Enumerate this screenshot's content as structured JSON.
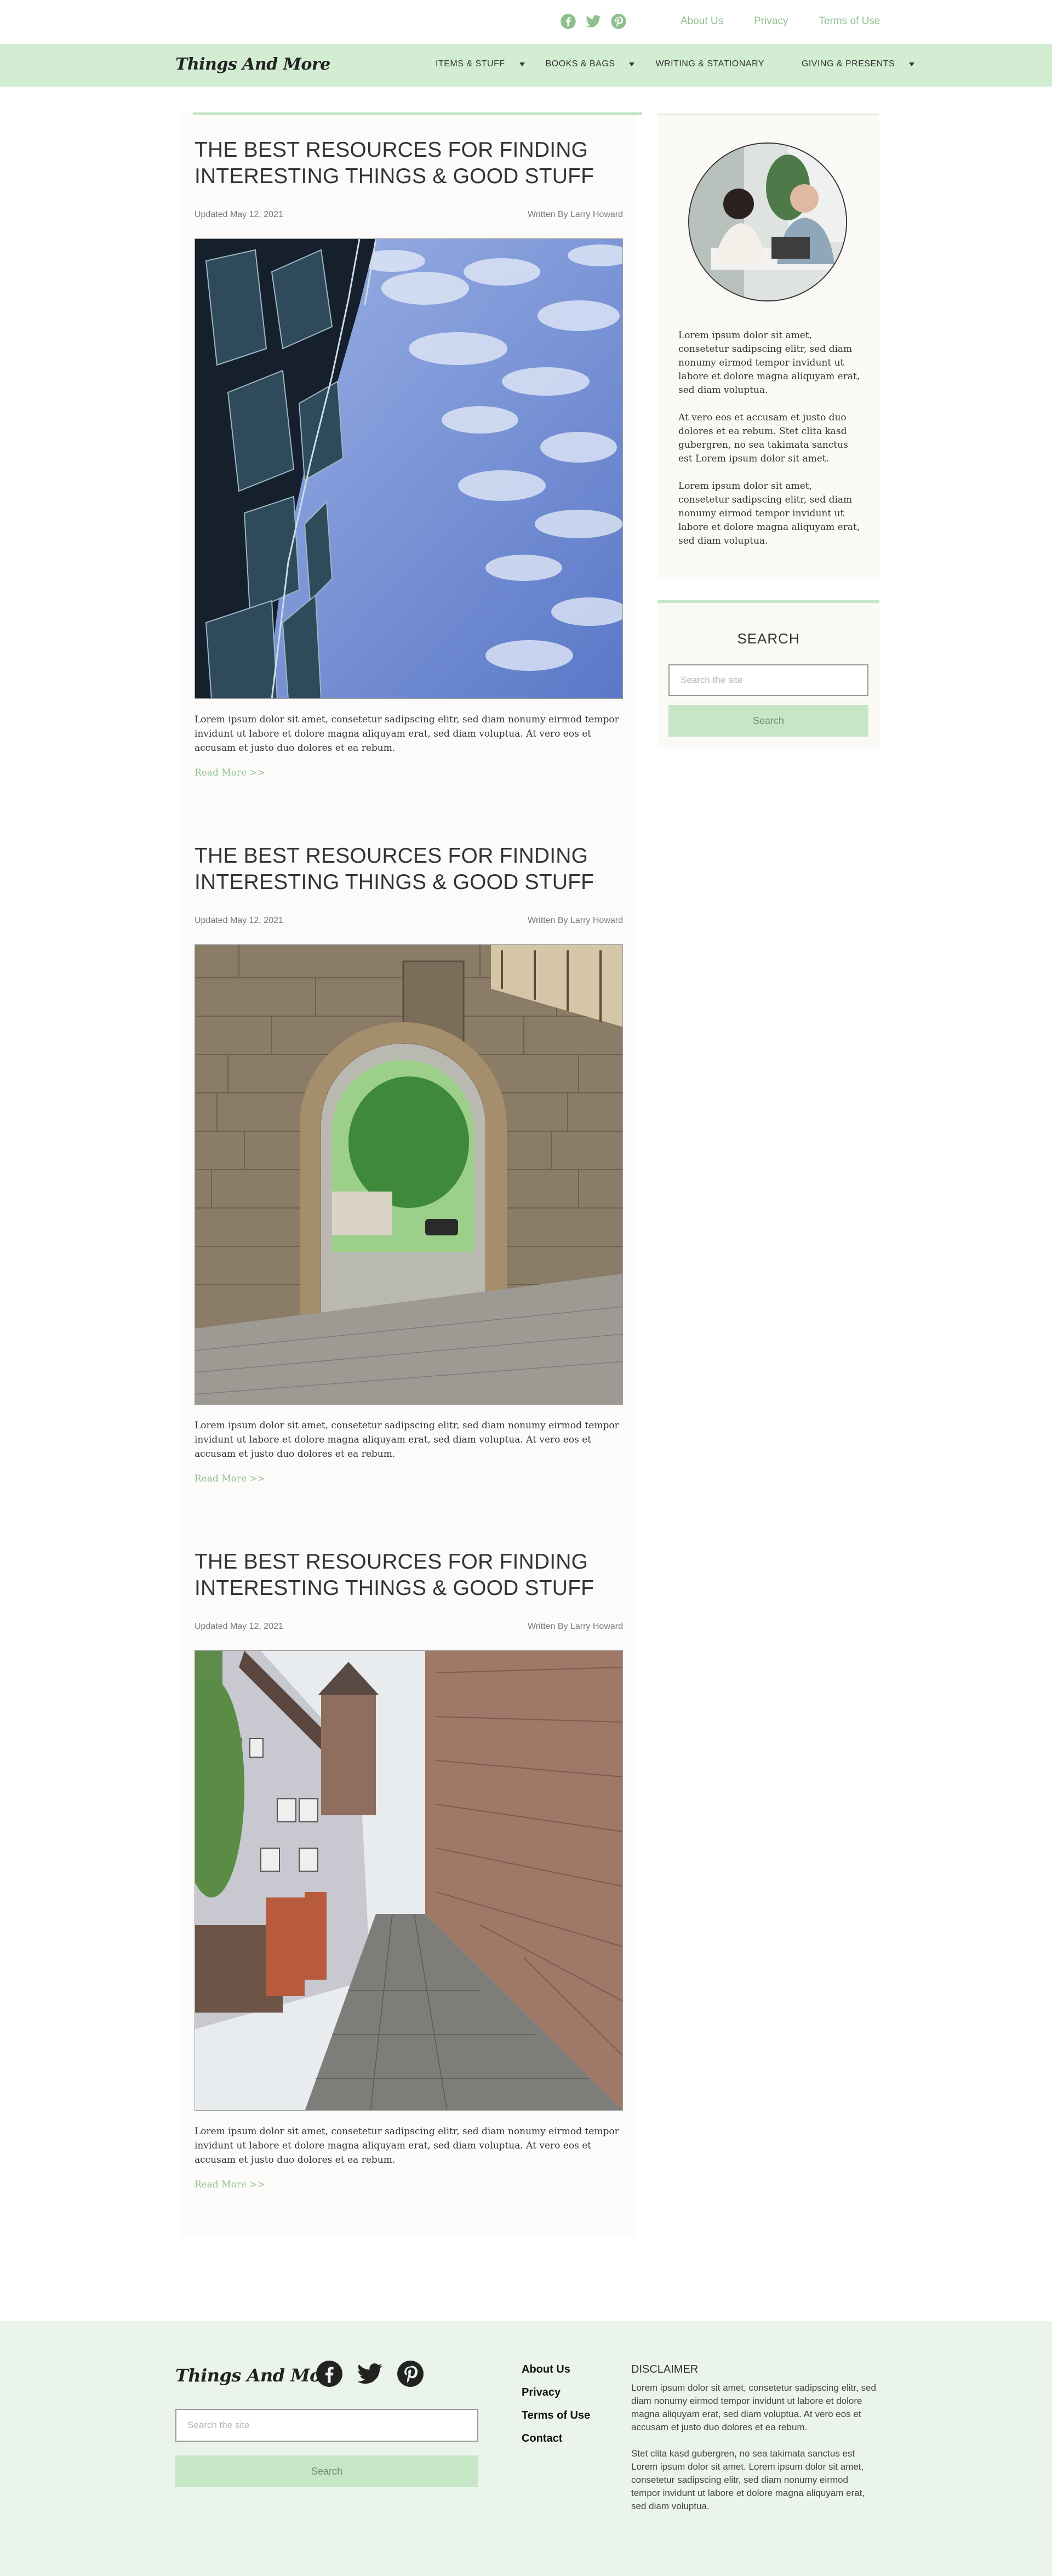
{
  "header": {
    "social": [
      {
        "icon": "facebook-icon"
      },
      {
        "icon": "twitter-icon"
      },
      {
        "icon": "pinterest-icon"
      }
    ],
    "links": [
      "About Us",
      "Privacy",
      "Terms of Use"
    ]
  },
  "nav": {
    "logo": "Things And More",
    "items": [
      {
        "label": "ITEMS & STUFF",
        "dropdown": true
      },
      {
        "label": "BOOKS & BAGS",
        "dropdown": true
      },
      {
        "label": "WRITING & STATIONARY",
        "dropdown": false
      },
      {
        "label": "GIVING & PRESENTS",
        "dropdown": true
      }
    ]
  },
  "posts": [
    {
      "title": "THE BEST RESOURCES FOR FINDING INTERESTING THINGS & GOOD STUFF",
      "date": "Updated May 12, 2021",
      "author": "Written By Larry Howard",
      "image": "glass-building-photo",
      "excerpt": "Lorem ipsum dolor sit amet, consetetur sadipscing elitr, sed diam nonumy eirmod tempor invidunt ut labore et dolore magna aliquyam erat, sed diam voluptua. At vero eos et accusam et justo duo dolores et ea rebum.",
      "read_more": "Read More >>"
    },
    {
      "title": "THE BEST RESOURCES FOR FINDING INTERESTING THINGS & GOOD STUFF",
      "date": "Updated May 12, 2021",
      "author": "Written By Larry Howard",
      "image": "stone-archway-photo",
      "excerpt": "Lorem ipsum dolor sit amet, consetetur sadipscing elitr, sed diam nonumy eirmod tempor invidunt ut labore et dolore magna aliquyam erat, sed diam voluptua. At vero eos et accusam et justo duo dolores et ea rebum.",
      "read_more": "Read More >>"
    },
    {
      "title": "THE BEST RESOURCES FOR FINDING INTERESTING THINGS & GOOD STUFF",
      "date": "Updated May 12, 2021",
      "author": "Written By Larry Howard",
      "image": "cobblestone-alley-photo",
      "excerpt": "Lorem ipsum dolor sit amet, consetetur sadipscing elitr, sed diam nonumy eirmod tempor invidunt ut labore et dolore magna aliquyam erat, sed diam voluptua. At vero eos et accusam et justo duo dolores et ea rebum.",
      "read_more": "Read More >>"
    }
  ],
  "sidebar": {
    "paragraphs": [
      "Lorem ipsum dolor sit amet, consetetur sadipscing elitr, sed diam nonumy eirmod tempor invidunt ut labore et dolore magna aliquyam erat, sed diam voluptua.",
      "At vero eos et accusam et justo duo dolores et ea rebum. Stet clita kasd gubergren, no sea takimata sanctus est Lorem ipsum dolor sit amet.",
      "Lorem ipsum dolor sit amet, consetetur sadipscing elitr, sed diam nonumy eirmod tempor invidunt ut labore et dolore magna aliquyam erat, sed diam voluptua."
    ],
    "search": {
      "heading": "SEARCH",
      "placeholder": "Search the site",
      "button": "Search"
    }
  },
  "footer": {
    "logo": "Things And More",
    "search": {
      "placeholder": "Search the site",
      "button": "Search"
    },
    "links": [
      "About Us",
      "Privacy",
      "Terms of Use",
      "Contact"
    ],
    "disclaimer": {
      "heading": "DISCLAIMER",
      "paragraphs": [
        "Lorem ipsum dolor sit amet, consetetur sadipscing elitr, sed diam nonumy eirmod tempor invidunt ut labore et dolore magna aliquyam erat, sed diam voluptua. At vero eos et accusam et justo duo dolores et ea rebum.",
        "Stet clita kasd gubergren, no sea takimata sanctus est Lorem ipsum dolor sit amet. Lorem ipsum dolor sit amet, consetetur sadipscing elitr, sed diam nonumy eirmod tempor invidunt ut labore et dolore magna aliquyam erat, sed diam voluptua."
      ]
    }
  },
  "colors": {
    "accent": "#d3edd3",
    "accent_text": "#8fbf8f",
    "footer_bg": "#eaf4ea"
  }
}
